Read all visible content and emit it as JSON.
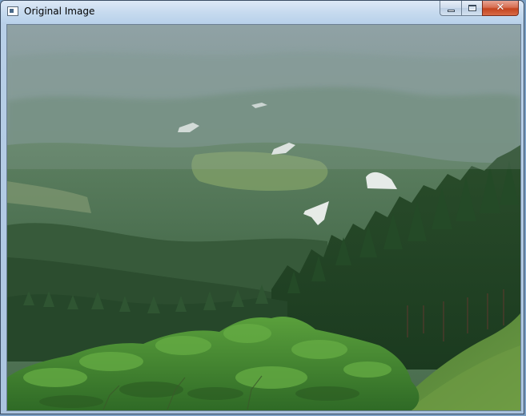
{
  "window": {
    "title": "Original Image",
    "icon": "app-window-icon",
    "controls": {
      "minimize": "minimize-icon",
      "maximize": "maximize-icon",
      "close": "close-icon"
    }
  },
  "image": {
    "description_icon": "landscape-photo",
    "colors": {
      "sky_haze": "#8fa3a6",
      "distant_hills": "#6f8a84",
      "valley": "#55764f",
      "forest_dark": "#1f3d22",
      "forest_light": "#3f7a2f",
      "grass": "#5f8f3a",
      "water": "#e8ece8"
    }
  }
}
